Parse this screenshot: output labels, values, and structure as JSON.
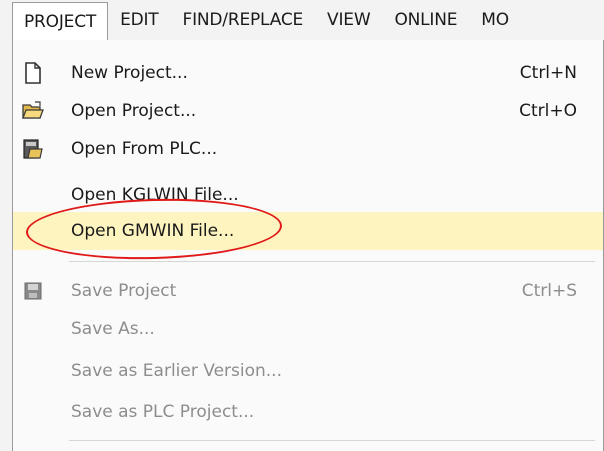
{
  "menubar": {
    "items": [
      {
        "label": "PROJECT",
        "active": true
      },
      {
        "label": "EDIT"
      },
      {
        "label": "FIND/REPLACE"
      },
      {
        "label": "VIEW"
      },
      {
        "label": "ONLINE"
      },
      {
        "label": "MO"
      }
    ]
  },
  "project_menu": {
    "items": [
      {
        "label": "New Project...",
        "shortcut": "Ctrl+N",
        "icon": "new-document-icon"
      },
      {
        "label": "Open Project...",
        "shortcut": "Ctrl+O",
        "icon": "open-folder-icon"
      },
      {
        "label": "Open From PLC...",
        "icon": "plc-open-icon"
      },
      {
        "label": "Open KGLWIN File..."
      },
      {
        "label": "Open GMWIN File...",
        "highlighted": true
      },
      {
        "label": "Save Project",
        "shortcut": "Ctrl+S",
        "icon": "save-disk-icon",
        "disabled": true
      },
      {
        "label": "Save As...",
        "disabled": true
      },
      {
        "label": "Save as Earlier Version...",
        "disabled": true
      },
      {
        "label": "Save as PLC Project...",
        "disabled": true
      }
    ]
  },
  "colors": {
    "hover_background": "#fdf4bf",
    "annotation_ring": "#e01919",
    "disabled_text": "#8d8d8d"
  }
}
